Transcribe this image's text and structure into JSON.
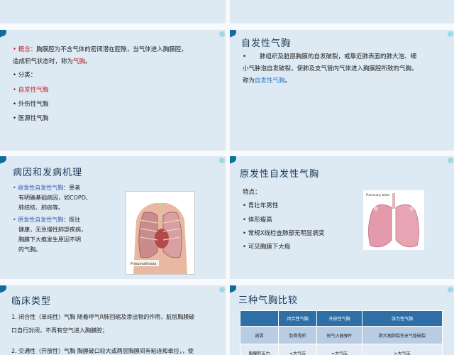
{
  "slide3": {
    "definition_label": "概念：",
    "definition_text_1": "胸膜腔为不含气体的密闭潜在腔隙，当气体进入胸膜腔，",
    "definition_text_2": "造成积气状态时，称为",
    "definition_term": "气胸",
    "definition_end": "。",
    "classification_label": "分类：",
    "types": [
      "自发性气胸",
      "外伤性气胸",
      "医源性气胸"
    ]
  },
  "slide4": {
    "title": "自发性气胸",
    "text_1": "肺组织及脏层胸膜的自发破裂，或靠近肺表面的肺大泡、细",
    "text_2": "小气肿泡自发破裂，使肺及支气管内气体进入胸膜腔所致的气胸，",
    "text_3_prefix": "称为",
    "text_3_term": "自发性气胸",
    "text_3_end": "。"
  },
  "slide5": {
    "title": "病因和发病机理",
    "secondary_term": "继发性自发性气胸",
    "secondary_lines": [
      "：患者",
      "有明确基础病因，如COPD、",
      "肺结核、肺癌等。"
    ],
    "primary_term": "原发性自发性气胸",
    "primary_lines": [
      "：既往",
      "健康，无急慢性肺部疾病，",
      "胸膜下大疱发生原因不明",
      "的气胸。"
    ],
    "image_caption": "Pneumothorax"
  },
  "slide6": {
    "title": "原发性自发性气胸",
    "features_label": "特点：",
    "features": [
      "青壮年男性",
      "体形瘦高",
      "常规X线检查肺部无明显病变",
      "可见胸膜下大疱"
    ],
    "image_caption": "Pulmonary blebs"
  },
  "slide7": {
    "title": "临床类型",
    "item1_line1": "1. 闭合性（单纯性）气胸  随着呼气R肺回缩及渗出物的作用，脏层胸膜破",
    "item1_line2": "口自行封闭，不再有空气进入胸膜腔；",
    "item2_line1": "2. 交通性（开放性）气胸  胸膜破口较大或两层胸膜间有粘连和牵拉，，使"
  },
  "slide8": {
    "title": "三种气胸比较",
    "headers": [
      "",
      "闭合性气胸",
      "开放性气胸",
      "张力性气胸"
    ],
    "rows": [
      [
        "病因",
        "肋骨骨折",
        "锐气火器弹片",
        "肺大疱肺裂伤支气管破裂"
      ],
      [
        "胸膜腔压力",
        "<大气压",
        "=大气压",
        ">大气压"
      ]
    ]
  }
}
